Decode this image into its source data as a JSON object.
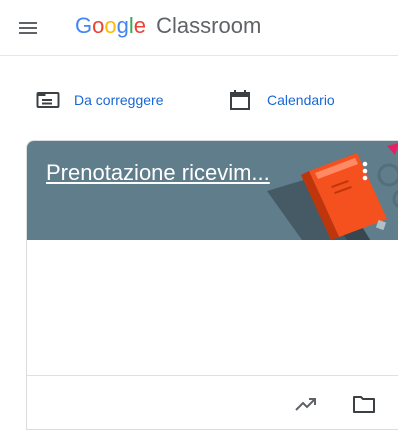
{
  "app": {
    "logo_google": [
      "G",
      "o",
      "o",
      "g",
      "l",
      "e"
    ],
    "logo_product": "Classroom",
    "google_colors": [
      "#4285F4",
      "#EA4335",
      "#FBBC05",
      "#4285F4",
      "#34A853",
      "#EA4335"
    ]
  },
  "quicklinks": {
    "to_review_label": "Da correggere",
    "calendar_label": "Calendario"
  },
  "class_card": {
    "title": "Prenotazione ricevim...",
    "header_color": "#607d8b"
  },
  "icons": {
    "menu": "menu-icon",
    "to_review": "assignment-inbox-icon",
    "calendar": "calendar-icon",
    "more": "more-vert-icon",
    "trending": "trending-up-icon",
    "folder": "folder-icon"
  },
  "colors": {
    "link_blue": "#1967d2",
    "icon_gray": "#5f6368",
    "book_orange": "#f4511e"
  }
}
